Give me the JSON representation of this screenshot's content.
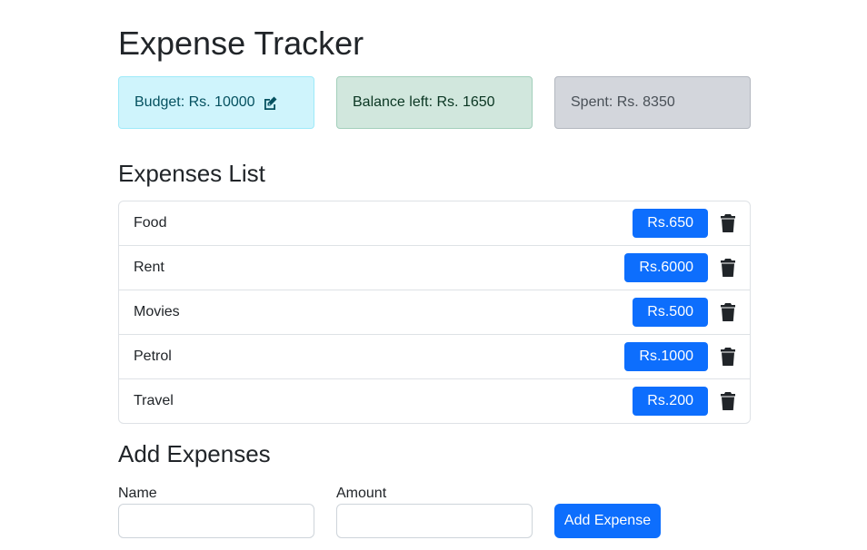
{
  "page": {
    "title": "Expense Tracker"
  },
  "cards": {
    "budget": "Budget: Rs. 10000",
    "balance": "Balance left: Rs. 1650",
    "spent": "Spent: Rs. 8350"
  },
  "icons": {
    "edit": "pen-to-square-icon",
    "delete": "trash-icon"
  },
  "expenses": {
    "heading": "Expenses List",
    "items": [
      {
        "name": "Food",
        "amount": "Rs.650"
      },
      {
        "name": "Rent",
        "amount": "Rs.6000"
      },
      {
        "name": "Movies",
        "amount": "Rs.500"
      },
      {
        "name": "Petrol",
        "amount": "Rs.1000"
      },
      {
        "name": "Travel",
        "amount": "Rs.200"
      }
    ]
  },
  "form": {
    "heading": "Add Expenses",
    "name_label": "Name",
    "name_value": "",
    "amount_label": "Amount",
    "amount_value": "",
    "submit_label": "Add Expense"
  },
  "colors": {
    "primary": "#0d6efd",
    "info_bg": "#cff4fc",
    "success_bg": "#d1e7dd",
    "secondary_bg": "#d3d6dc"
  }
}
